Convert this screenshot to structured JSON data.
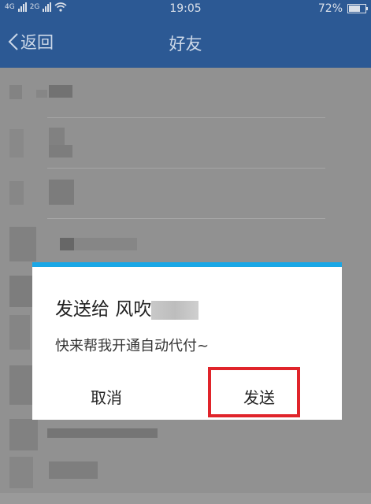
{
  "status_bar": {
    "network": "4G",
    "network2": "2G",
    "time": "19:05",
    "battery_percent": "72%",
    "battery_level": 0.72
  },
  "nav": {
    "back_label": "返回",
    "title": "好友"
  },
  "dialog": {
    "title_prefix": "发送给 风",
    "title_visible_tail": "吹",
    "message": "快来帮我开通自动代付~",
    "cancel_label": "取消",
    "send_label": "发送",
    "accent": "#1aa7e6"
  },
  "highlight_color": "#e0242a"
}
